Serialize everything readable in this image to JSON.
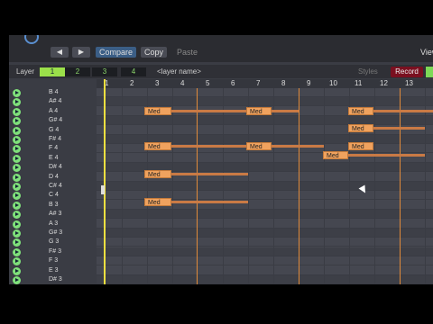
{
  "toolbar": {
    "prev_icon": "◀",
    "next_icon": "▶",
    "compare_label": "Compare",
    "copy_label": "Copy",
    "paste_label": "Paste",
    "view_label": "View"
  },
  "layer_bar": {
    "layer_label": "Layer",
    "layers": [
      "1",
      "2",
      "3",
      "4"
    ],
    "layer_name_placeholder": "<layer name>",
    "styles_label": "Styles",
    "record_label": "Record"
  },
  "ruler": [
    "1",
    "2",
    "3",
    "4",
    "5",
    "6",
    "7",
    "8",
    "9",
    "10",
    "11",
    "12",
    "13"
  ],
  "keys": [
    "B 4",
    "A# 4",
    "A 4",
    "G# 4",
    "G 4",
    "F# 4",
    "F 4",
    "E 4",
    "D# 4",
    "D 4",
    "C# 4",
    "C 4",
    "B 3",
    "A# 3",
    "A 3",
    "G# 3",
    "G 3",
    "F# 3",
    "F 3",
    "E 3",
    "D# 3"
  ],
  "notes": [
    {
      "label": "Med",
      "key": "A 4"
    },
    {
      "label": "Med",
      "key": "A 4"
    },
    {
      "label": "Med",
      "key": "A 4"
    },
    {
      "label": "Med",
      "key": "G 4"
    },
    {
      "label": "Med",
      "key": "F 4"
    },
    {
      "label": "Med",
      "key": "F 4"
    },
    {
      "label": "Med",
      "key": "F 4"
    },
    {
      "label": "Med",
      "key": "E 4"
    },
    {
      "label": "Med",
      "key": "D 4"
    },
    {
      "label": "Med",
      "key": "B 3"
    }
  ]
}
